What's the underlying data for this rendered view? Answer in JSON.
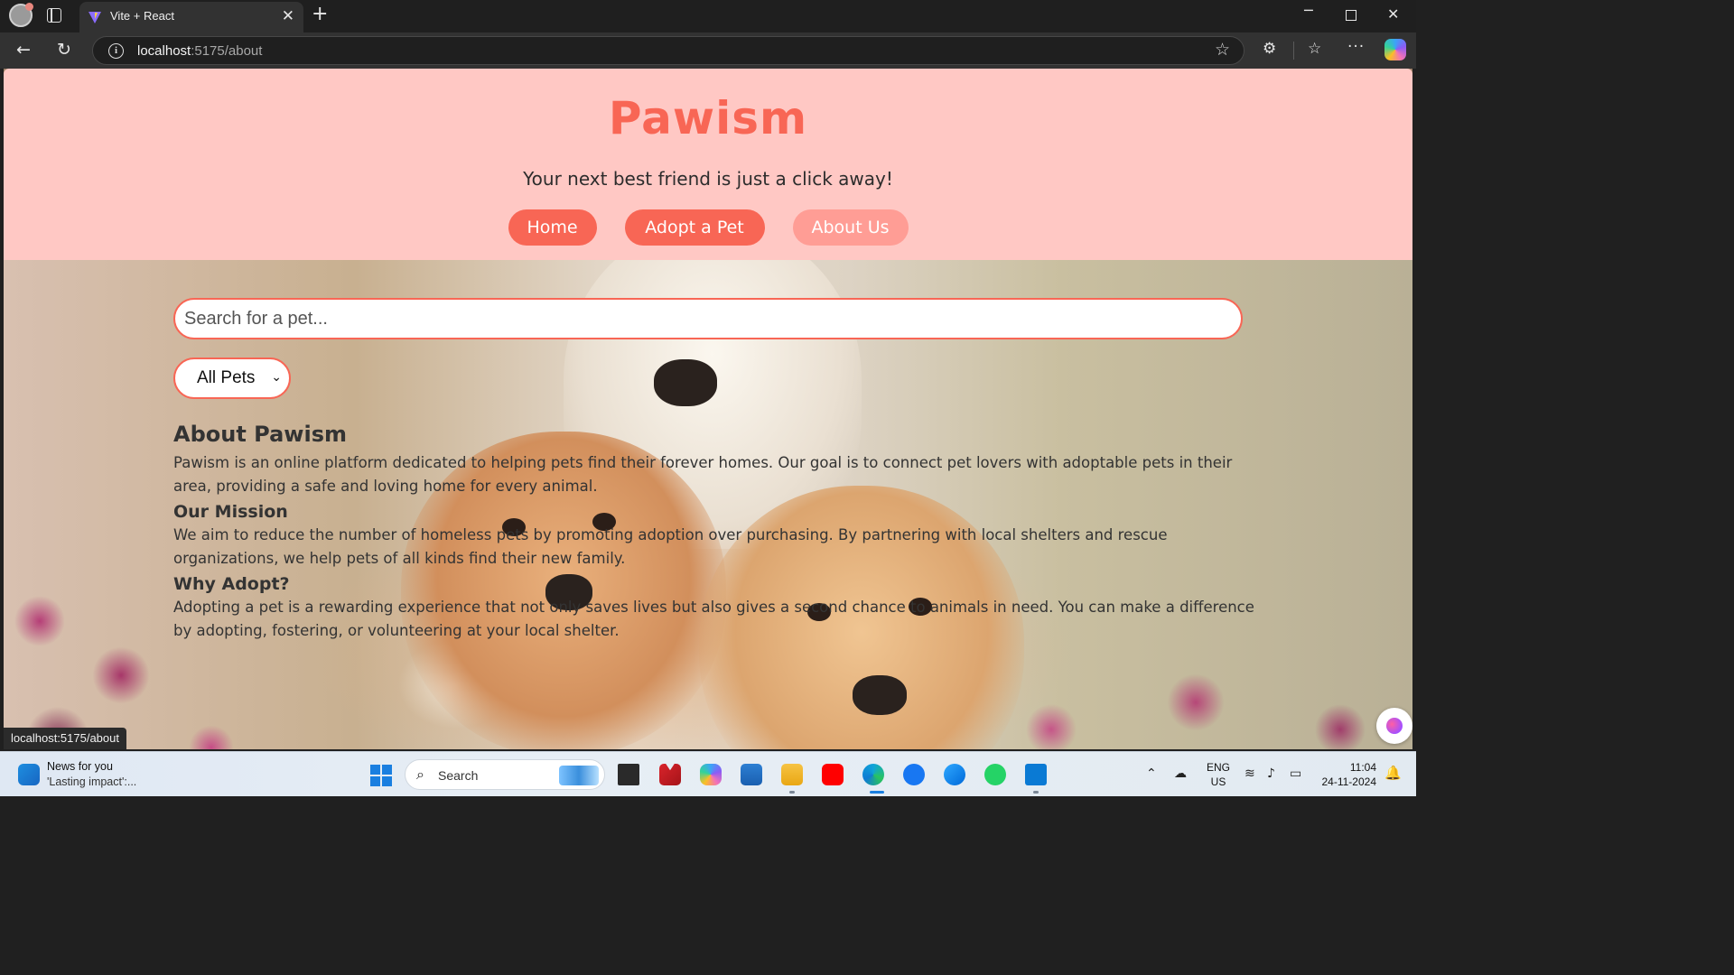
{
  "browser": {
    "tab_title": "Vite + React",
    "tab_close": "✕",
    "new_tab": "+",
    "url_host": "localhost",
    "url_path": ":5175/about",
    "minimize": "─",
    "close": "✕",
    "more": "···",
    "status_link": "localhost:5175/about"
  },
  "header": {
    "brand": "Pawism",
    "tagline": "Your next best friend is just a click away!",
    "nav": [
      {
        "label": "Home",
        "active": false
      },
      {
        "label": "Adopt a Pet",
        "active": false
      },
      {
        "label": "About Us",
        "active": true
      }
    ]
  },
  "search": {
    "placeholder": "Search for a pet..."
  },
  "filter": {
    "selected": "All Pets"
  },
  "about": {
    "title": "About Pawism",
    "intro": "Pawism is an online platform dedicated to helping pets find their forever homes. Our goal is to connect pet lovers with adoptable pets in their area, providing a safe and loving home for every animal.",
    "mission_title": "Our Mission",
    "mission_text": "We aim to reduce the number of homeless pets by promoting adoption over purchasing. By partnering with local shelters and rescue organizations, we help pets of all kinds find their new family.",
    "why_title": "Why Adopt?",
    "why_text": "Adopting a pet is a rewarding experience that not only saves lives but also gives a second chance to animals in need. You can make a difference by adopting, fostering, or volunteering at your local shelter."
  },
  "taskbar": {
    "news_title": "News for you",
    "news_sub": "'Lasting impact':...",
    "search_label": "Search",
    "lang_1": "ENG",
    "lang_2": "US",
    "time": "11:04",
    "date": "24-11-2024"
  },
  "colors": {
    "header_bg": "#ffc8c4",
    "brand": "#f86655",
    "nav_button": "#f86655",
    "nav_button_active": "#ff9d95"
  }
}
